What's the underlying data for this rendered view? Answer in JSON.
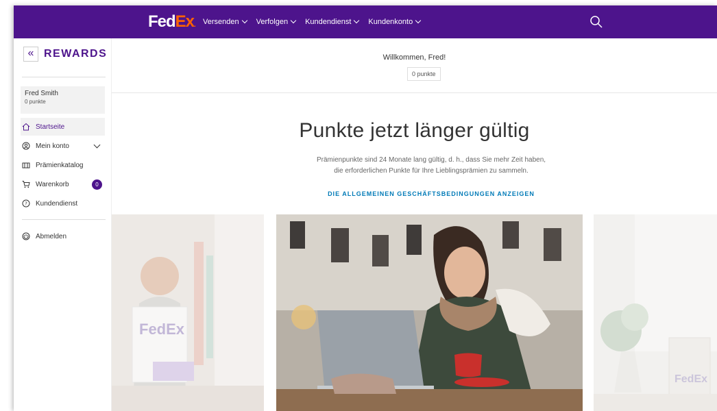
{
  "header": {
    "logo_fed": "Fed",
    "logo_ex": "Ex",
    "nav": [
      {
        "label": "Versenden"
      },
      {
        "label": "Verfolgen"
      },
      {
        "label": "Kundendienst"
      },
      {
        "label": "Kundenkonto"
      }
    ],
    "search_icon": "search-icon",
    "brand_color": "#4d148c",
    "accent_color": "#ff6200"
  },
  "sidebar": {
    "title": "REWARDS",
    "collapse_icon": "«",
    "user": {
      "name": "Fred Smith",
      "points": "0 punkte"
    },
    "items": [
      {
        "label": "Startseite",
        "icon": "home-icon",
        "active": true
      },
      {
        "label": "Mein konto",
        "icon": "user-icon",
        "expandable": true
      },
      {
        "label": "Prämienkatalog",
        "icon": "catalog-icon"
      },
      {
        "label": "Warenkorb",
        "icon": "cart-icon",
        "badge": "0"
      },
      {
        "label": "Kundendienst",
        "icon": "help-icon"
      }
    ],
    "logout": {
      "label": "Abmelden",
      "icon": "logout-icon"
    }
  },
  "main": {
    "welcome": "Willkommen, Fred!",
    "points_pill": "0 punkte",
    "hero_title": "Punkte jetzt länger gültig",
    "hero_text": "Prämienpunkte sind 24 Monate lang gültig, d. h., dass Sie mehr Zeit haben, die erforderlichen Punkte für Ihre Lieblingsprämien zu sammeln.",
    "hero_link": "DIE ALLGEMEINEN GESCHÄFTSBEDINGUNGEN ANZEIGEN",
    "link_color": "#007ab7"
  }
}
